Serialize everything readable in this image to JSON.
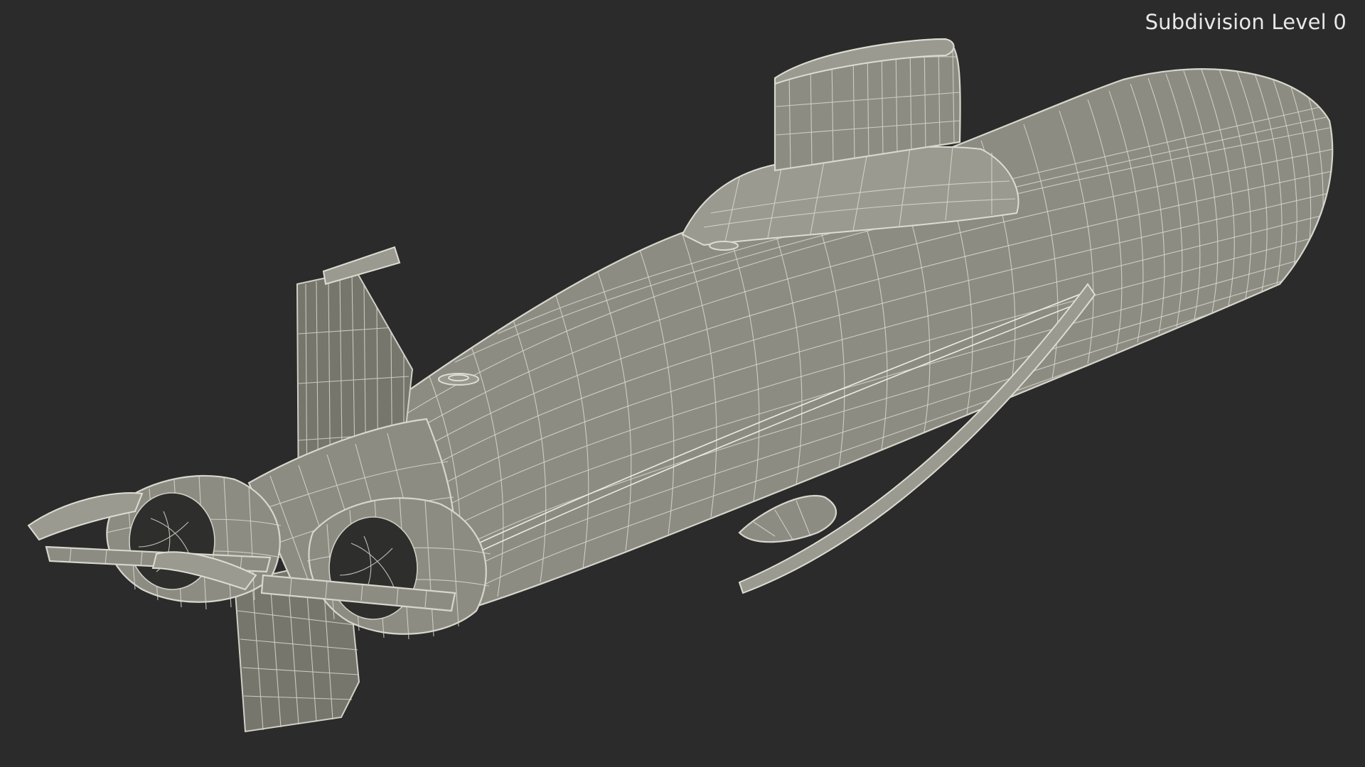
{
  "viewport": {
    "overlay_label": "Subdivision Level 0",
    "background_color": "#2b2b2b",
    "model_fill_color": "#8c8c82",
    "wireframe_color": "#d9d9cf"
  }
}
